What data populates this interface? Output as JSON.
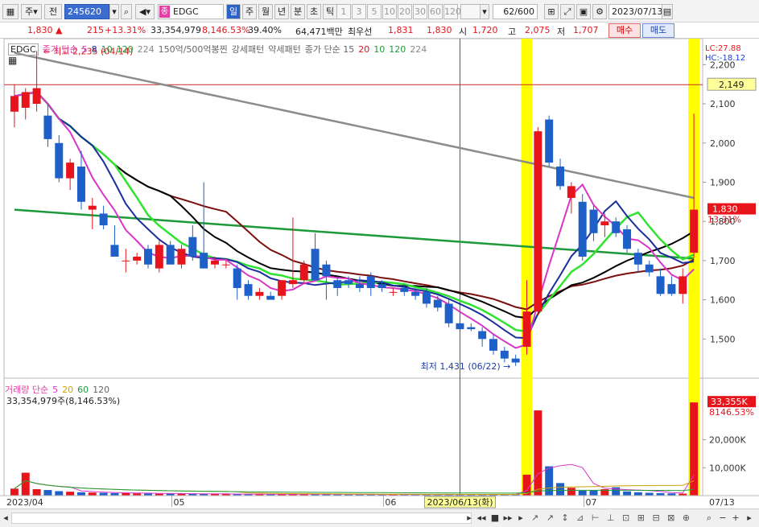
{
  "toolbar": {
    "mode_stock": "주",
    "mode_prev": "전",
    "code": "245620",
    "name": "EDGC",
    "name_badge": "종",
    "periods": [
      "일",
      "주",
      "월",
      "년",
      "분",
      "초",
      "틱"
    ],
    "active_period": "일",
    "numbers": [
      "1",
      "3",
      "5",
      "10",
      "20",
      "30",
      "60",
      "120"
    ],
    "count": "62",
    "count_total": "/600",
    "date": "2023/07/13"
  },
  "info": {
    "price": "1,830",
    "change": "215",
    "change_pct": "+13.31%",
    "volume": "33,354,979",
    "volume_pct": "8,146.53%",
    "turnover_pct": "39.40%",
    "trade_amount": "64,471백만",
    "best_label": "최우선",
    "best_ask": "1,831",
    "best_bid": "1,830",
    "open_label": "시",
    "open": "1,720",
    "high_label": "고",
    "high": "2,075",
    "low_label": "저",
    "low": "1,707",
    "buy_label": "매수",
    "sell_label": "매도"
  },
  "legend": {
    "symbol": "EDGC",
    "ma_label": "종가 단순",
    "ma_periods": [
      "5",
      "8",
      "10",
      "120",
      "224"
    ],
    "pattern_a": "150억/500억봉찐",
    "pattern_b": "강세패턴",
    "pattern_c": "약세패턴",
    "ma2_label": "종가 단순 15",
    "ma2_periods": [
      "20",
      "10",
      "120",
      "224"
    ],
    "volume_label": "거래량 단순",
    "volume_periods": [
      "5",
      "20",
      "60",
      "120"
    ],
    "volume_value": "33,354,979주(8,146.53%)"
  },
  "annotations": {
    "high": "최고 2,235 (04/14)",
    "low": "최저 1,431 (06/22)",
    "lc": "LC:27.88",
    "hc": "HC:-18.12",
    "crosshair_price": "2,149",
    "last_price": "1,830",
    "last_pct": "13.31%",
    "vol_last": "33,355K",
    "vol_last_pct": "8146.53%",
    "crosshair_date": "2023/06/13(화)"
  },
  "axes": {
    "x_labels": [
      "2023/04",
      "05",
      "06",
      "07",
      "07/13"
    ],
    "y_labels": [
      "2,200",
      "2,100",
      "2,000",
      "1,900",
      "1,800",
      "1,700",
      "1,600",
      "1,500"
    ],
    "vol_labels": [
      "20,000K",
      "10,000K"
    ]
  },
  "colors": {
    "up": "#e8141b",
    "down": "#1e5fc8",
    "ma5": "#d936c8",
    "ma8": "#1a2e9c",
    "ma10": "#2fe32f",
    "ma120": "#000000",
    "ma224": "#7a1010",
    "ma_long": "#1e9a3a",
    "ma_gray": "#8c8c8c",
    "highlight": "#ffff00"
  },
  "chart_data": {
    "type": "candlestick",
    "title": "EDGC",
    "ylim": [
      1400,
      2250
    ],
    "candles": [
      {
        "date": "04/11",
        "o": 2080,
        "h": 2150,
        "l": 2040,
        "c": 2120
      },
      {
        "date": "04/12",
        "o": 2090,
        "h": 2140,
        "l": 2060,
        "c": 2130
      },
      {
        "date": "04/14",
        "o": 2100,
        "h": 2235,
        "l": 2080,
        "c": 2140
      },
      {
        "date": "04/17",
        "o": 2070,
        "h": 2100,
        "l": 1990,
        "c": 2010
      },
      {
        "date": "04/18",
        "o": 2000,
        "h": 2020,
        "l": 1900,
        "c": 1910
      },
      {
        "date": "04/19",
        "o": 1910,
        "h": 1960,
        "l": 1880,
        "c": 1950
      },
      {
        "date": "04/20",
        "o": 1940,
        "h": 1980,
        "l": 1830,
        "c": 1850
      },
      {
        "date": "04/21",
        "o": 1830,
        "h": 1860,
        "l": 1780,
        "c": 1840
      },
      {
        "date": "04/24",
        "o": 1820,
        "h": 1840,
        "l": 1780,
        "c": 1790
      },
      {
        "date": "04/25",
        "o": 1740,
        "h": 1790,
        "l": 1720,
        "c": 1710
      },
      {
        "date": "04/26",
        "o": 1700,
        "h": 1730,
        "l": 1670,
        "c": 1700
      },
      {
        "date": "04/27",
        "o": 1700,
        "h": 1720,
        "l": 1690,
        "c": 1710
      },
      {
        "date": "04/28",
        "o": 1730,
        "h": 1740,
        "l": 1680,
        "c": 1690
      },
      {
        "date": "05/02",
        "o": 1680,
        "h": 1750,
        "l": 1670,
        "c": 1740
      },
      {
        "date": "05/03",
        "o": 1740,
        "h": 1750,
        "l": 1690,
        "c": 1690
      },
      {
        "date": "05/04",
        "o": 1690,
        "h": 1740,
        "l": 1680,
        "c": 1730
      },
      {
        "date": "05/08",
        "o": 1760,
        "h": 1790,
        "l": 1700,
        "c": 1710
      },
      {
        "date": "05/09",
        "o": 1720,
        "h": 1900,
        "l": 1680,
        "c": 1680
      },
      {
        "date": "05/10",
        "o": 1690,
        "h": 1710,
        "l": 1680,
        "c": 1700
      },
      {
        "date": "05/11",
        "o": 1690,
        "h": 1700,
        "l": 1680,
        "c": 1690
      },
      {
        "date": "05/12",
        "o": 1680,
        "h": 1690,
        "l": 1600,
        "c": 1630
      },
      {
        "date": "05/15",
        "o": 1640,
        "h": 1650,
        "l": 1600,
        "c": 1610
      },
      {
        "date": "05/16",
        "o": 1610,
        "h": 1630,
        "l": 1600,
        "c": 1620
      },
      {
        "date": "05/17",
        "o": 1610,
        "h": 1620,
        "l": 1600,
        "c": 1600
      },
      {
        "date": "05/18",
        "o": 1610,
        "h": 1640,
        "l": 1600,
        "c": 1650
      },
      {
        "date": "05/19",
        "o": 1640,
        "h": 1810,
        "l": 1630,
        "c": 1650
      },
      {
        "date": "05/22",
        "o": 1650,
        "h": 1700,
        "l": 1640,
        "c": 1690
      },
      {
        "date": "05/23",
        "o": 1730,
        "h": 1770,
        "l": 1650,
        "c": 1650
      },
      {
        "date": "05/24",
        "o": 1690,
        "h": 1700,
        "l": 1600,
        "c": 1660
      },
      {
        "date": "05/25",
        "o": 1650,
        "h": 1660,
        "l": 1610,
        "c": 1630
      },
      {
        "date": "05/26",
        "o": 1650,
        "h": 1660,
        "l": 1630,
        "c": 1640
      },
      {
        "date": "05/30",
        "o": 1640,
        "h": 1660,
        "l": 1620,
        "c": 1630
      },
      {
        "date": "05/31",
        "o": 1660,
        "h": 1670,
        "l": 1610,
        "c": 1630
      },
      {
        "date": "06/01",
        "o": 1640,
        "h": 1650,
        "l": 1620,
        "c": 1630
      },
      {
        "date": "06/02",
        "o": 1620,
        "h": 1630,
        "l": 1610,
        "c": 1620
      },
      {
        "date": "06/05",
        "o": 1630,
        "h": 1640,
        "l": 1610,
        "c": 1620
      },
      {
        "date": "06/07",
        "o": 1620,
        "h": 1630,
        "l": 1600,
        "c": 1610
      },
      {
        "date": "06/08",
        "o": 1620,
        "h": 1630,
        "l": 1580,
        "c": 1590
      },
      {
        "date": "06/09",
        "o": 1600,
        "h": 1610,
        "l": 1570,
        "c": 1580
      },
      {
        "date": "06/12",
        "o": 1590,
        "h": 1600,
        "l": 1530,
        "c": 1540
      },
      {
        "date": "06/13",
        "o": 1540,
        "h": 1560,
        "l": 1520,
        "c": 1525
      },
      {
        "date": "06/14",
        "o": 1530,
        "h": 1540,
        "l": 1520,
        "c": 1525
      },
      {
        "date": "06/15",
        "o": 1520,
        "h": 1530,
        "l": 1480,
        "c": 1500
      },
      {
        "date": "06/16",
        "o": 1500,
        "h": 1510,
        "l": 1460,
        "c": 1470
      },
      {
        "date": "06/19",
        "o": 1470,
        "h": 1480,
        "l": 1440,
        "c": 1450
      },
      {
        "date": "06/22",
        "o": 1450,
        "h": 1460,
        "l": 1431,
        "c": 1440
      },
      {
        "date": "06/23",
        "o": 1480,
        "h": 1650,
        "l": 1460,
        "c": 1570
      },
      {
        "date": "06/26",
        "o": 1570,
        "h": 2040,
        "l": 1560,
        "c": 2030
      },
      {
        "date": "06/27",
        "o": 2060,
        "h": 2070,
        "l": 1940,
        "c": 1950
      },
      {
        "date": "06/28",
        "o": 1940,
        "h": 1960,
        "l": 1880,
        "c": 1890
      },
      {
        "date": "06/29",
        "o": 1860,
        "h": 1900,
        "l": 1820,
        "c": 1890
      },
      {
        "date": "06/30",
        "o": 1850,
        "h": 1870,
        "l": 1700,
        "c": 1710
      },
      {
        "date": "07/03",
        "o": 1830,
        "h": 1840,
        "l": 1750,
        "c": 1770
      },
      {
        "date": "07/04",
        "o": 1790,
        "h": 1820,
        "l": 1760,
        "c": 1800
      },
      {
        "date": "07/05",
        "o": 1800,
        "h": 1810,
        "l": 1760,
        "c": 1770
      },
      {
        "date": "07/06",
        "o": 1780,
        "h": 1790,
        "l": 1720,
        "c": 1730
      },
      {
        "date": "07/07",
        "o": 1720,
        "h": 1730,
        "l": 1670,
        "c": 1690
      },
      {
        "date": "07/10",
        "o": 1690,
        "h": 1700,
        "l": 1660,
        "c": 1670
      },
      {
        "date": "07/11",
        "o": 1660,
        "h": 1680,
        "l": 1610,
        "c": 1615
      },
      {
        "date": "07/12",
        "o": 1640,
        "h": 1660,
        "l": 1610,
        "c": 1615
      },
      {
        "date": "07/12b",
        "o": 1615,
        "h": 1680,
        "l": 1590,
        "c": 1660
      },
      {
        "date": "07/13",
        "o": 1720,
        "h": 2075,
        "l": 1707,
        "c": 1830
      }
    ],
    "volume": [
      2.5,
      8.2,
      2.3,
      2.0,
      1.6,
      1.4,
      1.2,
      1.1,
      1.0,
      0.9,
      0.9,
      0.8,
      0.8,
      0.7,
      0.7,
      0.7,
      0.6,
      0.6,
      0.6,
      0.6,
      0.5,
      0.5,
      0.5,
      0.5,
      0.5,
      0.6,
      0.5,
      0.5,
      0.5,
      0.4,
      0.4,
      0.4,
      0.4,
      0.4,
      0.4,
      0.4,
      0.4,
      0.4,
      0.4,
      0.4,
      0.4,
      0.4,
      0.4,
      0.4,
      0.4,
      0.4,
      7.5,
      30.5,
      10.5,
      4.5,
      2.8,
      1.8,
      2.0,
      2.3,
      3.0,
      1.5,
      1.2,
      1.0,
      0.9,
      0.8,
      0.7,
      33.355
    ],
    "volume_unit": "K (thousands of shares ×1000)"
  }
}
